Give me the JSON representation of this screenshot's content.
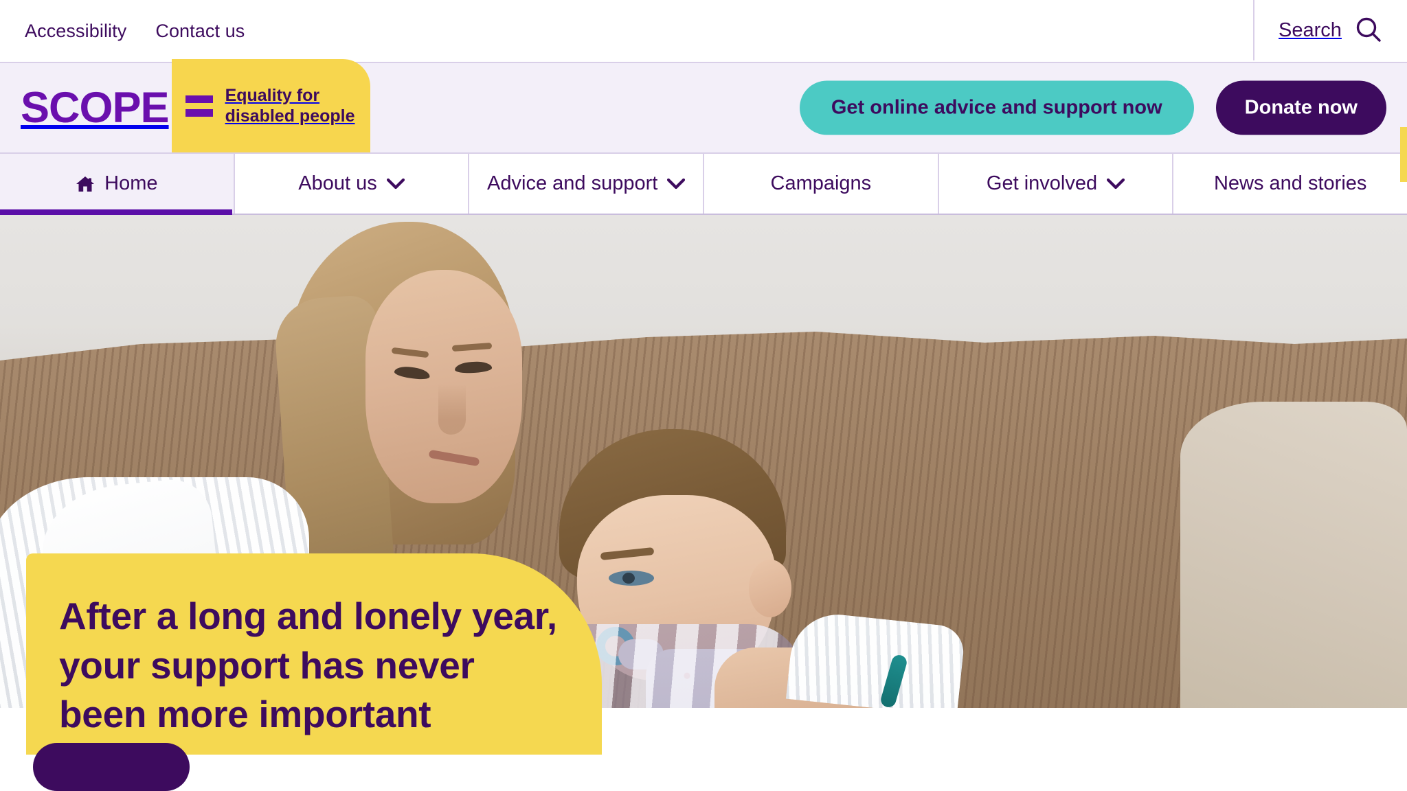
{
  "utility": {
    "links": [
      {
        "label": "Accessibility",
        "name": "accessibility"
      },
      {
        "label": "Contact us",
        "name": "contact-us"
      }
    ],
    "search_label": "Search",
    "search_icon": "search-icon"
  },
  "brand": {
    "logo_word": "SCOPE",
    "logo_tagline": "Equality for\ndisabled people",
    "equals_icon": "equals-icon",
    "advice_button": "Get online advice and support now",
    "donate_button": "Donate now"
  },
  "nav": {
    "items": [
      {
        "label": "Home",
        "icon": "home-icon",
        "has_chevron": false,
        "active": true
      },
      {
        "label": "About us",
        "icon": "",
        "has_chevron": true,
        "active": false
      },
      {
        "label": "Advice and support",
        "icon": "",
        "has_chevron": true,
        "active": false
      },
      {
        "label": "Campaigns",
        "icon": "",
        "has_chevron": false,
        "active": false
      },
      {
        "label": "Get involved",
        "icon": "",
        "has_chevron": true,
        "active": false
      },
      {
        "label": "News and stories",
        "icon": "",
        "has_chevron": false,
        "active": false
      }
    ]
  },
  "hero": {
    "title": "After a long and lonely year, your support has never been more important",
    "image_alt": "A woman in a white dressing gown holding a young boy with a pacifier on a brown corduroy sofa"
  },
  "colors": {
    "purple": "#3d0b5e",
    "bright_purple": "#6a0fad",
    "underline_purple": "#5b0fa8",
    "yellow": "#f5d850",
    "logo_yellow": "#f7d64e",
    "teal": "#4ccac4",
    "band_lavender": "#f3eff9",
    "divider": "#d9cfe8"
  }
}
